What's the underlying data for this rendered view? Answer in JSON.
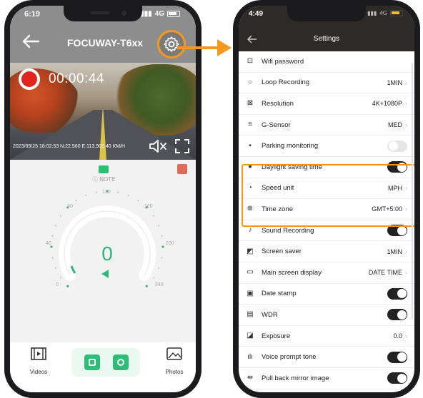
{
  "left_phone": {
    "status": {
      "time": "6:19",
      "network": "4G"
    },
    "header": {
      "title": "FOCUWAY-T6xx"
    },
    "recording": {
      "timer": "00:00:44"
    },
    "video_overlay": {
      "stamp": "2023/09/25 18:02:53 N:22.560 E:113.905 40 KM/H"
    },
    "note": {
      "label": "NOTE"
    },
    "speedometer": {
      "value": "0",
      "ticks": [
        "0",
        "40",
        "80",
        "120",
        "160",
        "200",
        "240"
      ]
    },
    "bottom_nav": {
      "videos_label": "Videos",
      "photos_label": "Photos"
    }
  },
  "right_phone": {
    "status": {
      "time": "4:49",
      "network": "4G"
    },
    "header": {
      "title": "Settings"
    },
    "settings": [
      {
        "icon": "lock-icon",
        "label": "Wifi password",
        "type": "none"
      },
      {
        "icon": "loop-icon",
        "label": "Loop Recording",
        "type": "value",
        "value": "1MIN"
      },
      {
        "icon": "resolution-icon",
        "label": "Resolution",
        "type": "value",
        "value": "4K+1080P"
      },
      {
        "icon": "g-sensor-icon",
        "label": "G-Sensor",
        "type": "value",
        "value": "MED"
      },
      {
        "icon": "parking-icon",
        "label": "Parking monitoring",
        "type": "toggle",
        "on": false
      },
      {
        "icon": "moon-icon",
        "label": "Daylight saving time",
        "type": "toggle",
        "on": true
      },
      {
        "icon": "gauge-icon",
        "label": "Speed unit",
        "type": "value",
        "value": "MPH"
      },
      {
        "icon": "globe-icon",
        "label": "Time zone",
        "type": "value",
        "value": "GMT+5:00"
      },
      {
        "icon": "mic-icon",
        "label": "Sound Recording",
        "type": "toggle",
        "on": true
      },
      {
        "icon": "screen-saver-icon",
        "label": "Screen saver",
        "type": "value",
        "value": "1MIN"
      },
      {
        "icon": "monitor-icon",
        "label": "Main screen display",
        "type": "value",
        "value": "DATE TIME"
      },
      {
        "icon": "date-stamp-icon",
        "label": "Date stamp",
        "type": "toggle",
        "on": true
      },
      {
        "icon": "wdr-icon",
        "label": "WDR",
        "type": "toggle",
        "on": true
      },
      {
        "icon": "exposure-icon",
        "label": "Exposure",
        "type": "value",
        "value": "0.0"
      },
      {
        "icon": "voice-icon",
        "label": "Voice prompt tone",
        "type": "toggle",
        "on": true
      },
      {
        "icon": "mirror-icon",
        "label": "Pull back mirror image",
        "type": "toggle",
        "on": true
      }
    ]
  },
  "colors": {
    "accent": "#f39a1e",
    "green": "#2db87a",
    "record": "#e0261f"
  }
}
